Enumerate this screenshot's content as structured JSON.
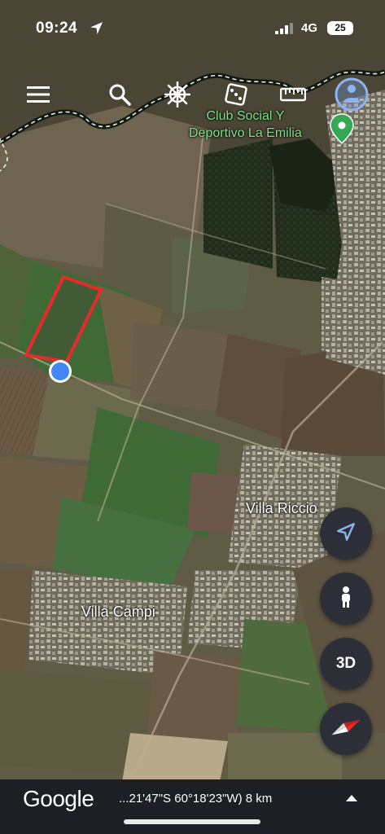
{
  "status_bar": {
    "time": "09:24",
    "network": "4G",
    "battery": "25"
  },
  "toolbar": {
    "menu_icon": "menu-icon",
    "search_icon": "search-icon",
    "voyager_icon": "ship-wheel-icon",
    "feeling_lucky_icon": "dice-icon",
    "measure_icon": "ruler-icon",
    "projects_icon": "pegman-circle-icon"
  },
  "map": {
    "poi_label_line1": "Club Social Y",
    "poi_label_line2": "Deportivo La Emilia",
    "place_labels": [
      "Villa Riccio",
      "Villa Campi"
    ],
    "accent_color": "#ea2a2a",
    "location_dot_color": "#4285f4",
    "poi_color": "#34a853"
  },
  "fabs": {
    "my_location_icon": "navigation-arrow-icon",
    "street_view_icon": "person-icon",
    "three_d_label": "3D",
    "compass_icon": "compass-icon"
  },
  "bottom_bar": {
    "logo": "Google",
    "coordinates": "...21'47\"S 60°18'23\"W) 8 km",
    "expand_icon": "chevron-up-icon"
  }
}
